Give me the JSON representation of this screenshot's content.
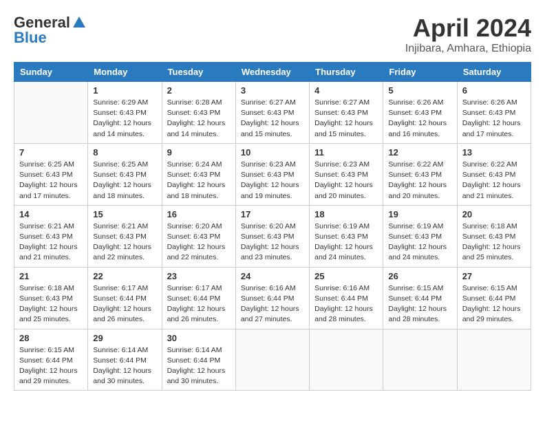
{
  "header": {
    "logo_general": "General",
    "logo_blue": "Blue",
    "month_title": "April 2024",
    "location": "Injibara, Amhara, Ethiopia"
  },
  "days_of_week": [
    "Sunday",
    "Monday",
    "Tuesday",
    "Wednesday",
    "Thursday",
    "Friday",
    "Saturday"
  ],
  "weeks": [
    [
      {
        "day": "",
        "empty": true
      },
      {
        "day": "1",
        "sunrise": "6:29 AM",
        "sunset": "6:43 PM",
        "daylight": "12 hours and 14 minutes."
      },
      {
        "day": "2",
        "sunrise": "6:28 AM",
        "sunset": "6:43 PM",
        "daylight": "12 hours and 14 minutes."
      },
      {
        "day": "3",
        "sunrise": "6:27 AM",
        "sunset": "6:43 PM",
        "daylight": "12 hours and 15 minutes."
      },
      {
        "day": "4",
        "sunrise": "6:27 AM",
        "sunset": "6:43 PM",
        "daylight": "12 hours and 15 minutes."
      },
      {
        "day": "5",
        "sunrise": "6:26 AM",
        "sunset": "6:43 PM",
        "daylight": "12 hours and 16 minutes."
      },
      {
        "day": "6",
        "sunrise": "6:26 AM",
        "sunset": "6:43 PM",
        "daylight": "12 hours and 17 minutes."
      }
    ],
    [
      {
        "day": "7",
        "sunrise": "6:25 AM",
        "sunset": "6:43 PM",
        "daylight": "12 hours and 17 minutes."
      },
      {
        "day": "8",
        "sunrise": "6:25 AM",
        "sunset": "6:43 PM",
        "daylight": "12 hours and 18 minutes."
      },
      {
        "day": "9",
        "sunrise": "6:24 AM",
        "sunset": "6:43 PM",
        "daylight": "12 hours and 18 minutes."
      },
      {
        "day": "10",
        "sunrise": "6:23 AM",
        "sunset": "6:43 PM",
        "daylight": "12 hours and 19 minutes."
      },
      {
        "day": "11",
        "sunrise": "6:23 AM",
        "sunset": "6:43 PM",
        "daylight": "12 hours and 20 minutes."
      },
      {
        "day": "12",
        "sunrise": "6:22 AM",
        "sunset": "6:43 PM",
        "daylight": "12 hours and 20 minutes."
      },
      {
        "day": "13",
        "sunrise": "6:22 AM",
        "sunset": "6:43 PM",
        "daylight": "12 hours and 21 minutes."
      }
    ],
    [
      {
        "day": "14",
        "sunrise": "6:21 AM",
        "sunset": "6:43 PM",
        "daylight": "12 hours and 21 minutes."
      },
      {
        "day": "15",
        "sunrise": "6:21 AM",
        "sunset": "6:43 PM",
        "daylight": "12 hours and 22 minutes."
      },
      {
        "day": "16",
        "sunrise": "6:20 AM",
        "sunset": "6:43 PM",
        "daylight": "12 hours and 22 minutes."
      },
      {
        "day": "17",
        "sunrise": "6:20 AM",
        "sunset": "6:43 PM",
        "daylight": "12 hours and 23 minutes."
      },
      {
        "day": "18",
        "sunrise": "6:19 AM",
        "sunset": "6:43 PM",
        "daylight": "12 hours and 24 minutes."
      },
      {
        "day": "19",
        "sunrise": "6:19 AM",
        "sunset": "6:43 PM",
        "daylight": "12 hours and 24 minutes."
      },
      {
        "day": "20",
        "sunrise": "6:18 AM",
        "sunset": "6:43 PM",
        "daylight": "12 hours and 25 minutes."
      }
    ],
    [
      {
        "day": "21",
        "sunrise": "6:18 AM",
        "sunset": "6:43 PM",
        "daylight": "12 hours and 25 minutes."
      },
      {
        "day": "22",
        "sunrise": "6:17 AM",
        "sunset": "6:44 PM",
        "daylight": "12 hours and 26 minutes."
      },
      {
        "day": "23",
        "sunrise": "6:17 AM",
        "sunset": "6:44 PM",
        "daylight": "12 hours and 26 minutes."
      },
      {
        "day": "24",
        "sunrise": "6:16 AM",
        "sunset": "6:44 PM",
        "daylight": "12 hours and 27 minutes."
      },
      {
        "day": "25",
        "sunrise": "6:16 AM",
        "sunset": "6:44 PM",
        "daylight": "12 hours and 28 minutes."
      },
      {
        "day": "26",
        "sunrise": "6:15 AM",
        "sunset": "6:44 PM",
        "daylight": "12 hours and 28 minutes."
      },
      {
        "day": "27",
        "sunrise": "6:15 AM",
        "sunset": "6:44 PM",
        "daylight": "12 hours and 29 minutes."
      }
    ],
    [
      {
        "day": "28",
        "sunrise": "6:15 AM",
        "sunset": "6:44 PM",
        "daylight": "12 hours and 29 minutes."
      },
      {
        "day": "29",
        "sunrise": "6:14 AM",
        "sunset": "6:44 PM",
        "daylight": "12 hours and 30 minutes."
      },
      {
        "day": "30",
        "sunrise": "6:14 AM",
        "sunset": "6:44 PM",
        "daylight": "12 hours and 30 minutes."
      },
      {
        "day": "",
        "empty": true
      },
      {
        "day": "",
        "empty": true
      },
      {
        "day": "",
        "empty": true
      },
      {
        "day": "",
        "empty": true
      }
    ]
  ]
}
